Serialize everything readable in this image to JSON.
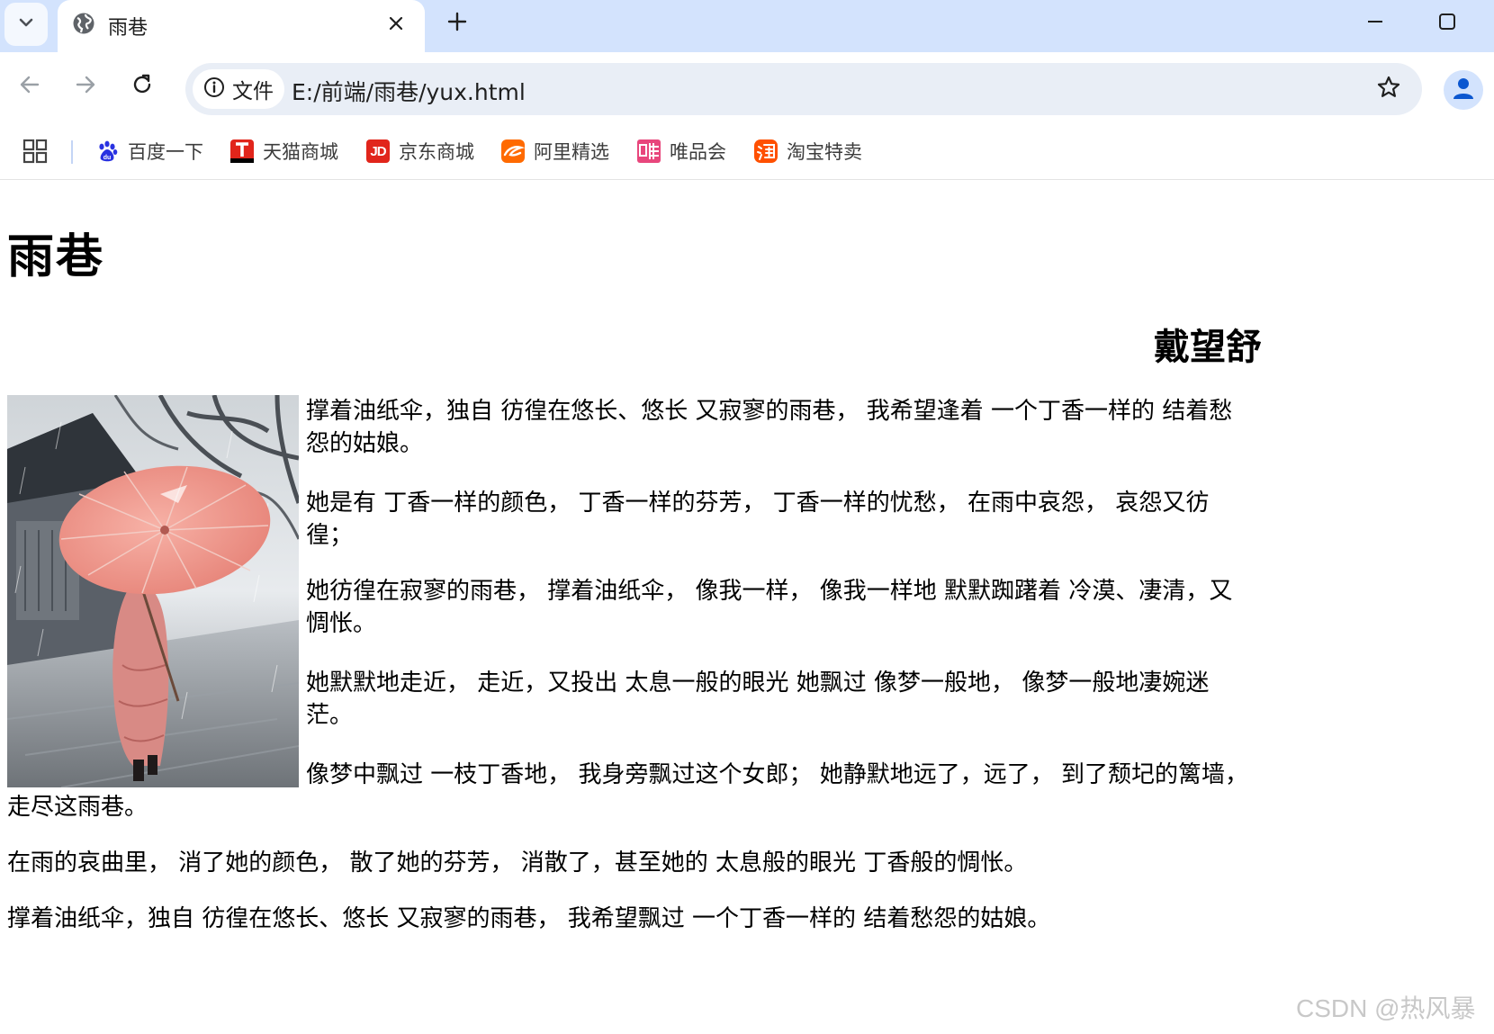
{
  "browser": {
    "tab": {
      "title": "雨巷"
    },
    "address_bar": {
      "site_info_label": "文件",
      "url": "E:/前端/雨巷/yux.html"
    },
    "bookmarks": [
      {
        "label": "百度一下",
        "icon": "baidu-paw-icon",
        "color": "#2932e1"
      },
      {
        "label": "天猫商城",
        "icon": "tmall-icon",
        "color": "#e1251b"
      },
      {
        "label": "京东商城",
        "icon": "jd-icon",
        "color": "#e1251b"
      },
      {
        "label": "阿里精选",
        "icon": "alibaba-icon",
        "color": "#ff6a00"
      },
      {
        "label": "唯品会",
        "icon": "vipshop-icon",
        "color": "#e8467c"
      },
      {
        "label": "淘宝特卖",
        "icon": "taobao-icon",
        "color": "#ff5000"
      }
    ]
  },
  "page": {
    "title": "雨巷",
    "author": "戴望舒",
    "image": {
      "subject": "woman-with-pink-oil-paper-umbrella-in-rain-alley"
    },
    "paragraphs": [
      "撑着油纸伞，独自 彷徨在悠长、悠长 又寂寥的雨巷， 我希望逢着 一个丁香一样的 结着愁怨的姑娘。",
      "她是有 丁香一样的颜色， 丁香一样的芬芳， 丁香一样的忧愁， 在雨中哀怨， 哀怨又彷徨；",
      "她彷徨在寂寥的雨巷， 撑着油纸伞， 像我一样， 像我一样地 默默踟躇着 冷漠、凄清，又惆怅。",
      "她默默地走近， 走近，又投出 太息一般的眼光 她飘过 像梦一般地， 像梦一般地凄婉迷茫。",
      "像梦中飘过 一枝丁香地， 我身旁飘过这个女郎； 她静默地远了，远了， 到了颓圮的篱墙， 走尽这雨巷。",
      "在雨的哀曲里， 消了她的颜色， 散了她的芬芳， 消散了，甚至她的 太息般的眼光 丁香般的惆怅。",
      "撑着油纸伞，独自 彷徨在悠长、悠长 又寂寥的雨巷， 我希望飘过 一个丁香一样的 结着愁怨的姑娘。"
    ]
  },
  "watermark": "CSDN @热风暴"
}
